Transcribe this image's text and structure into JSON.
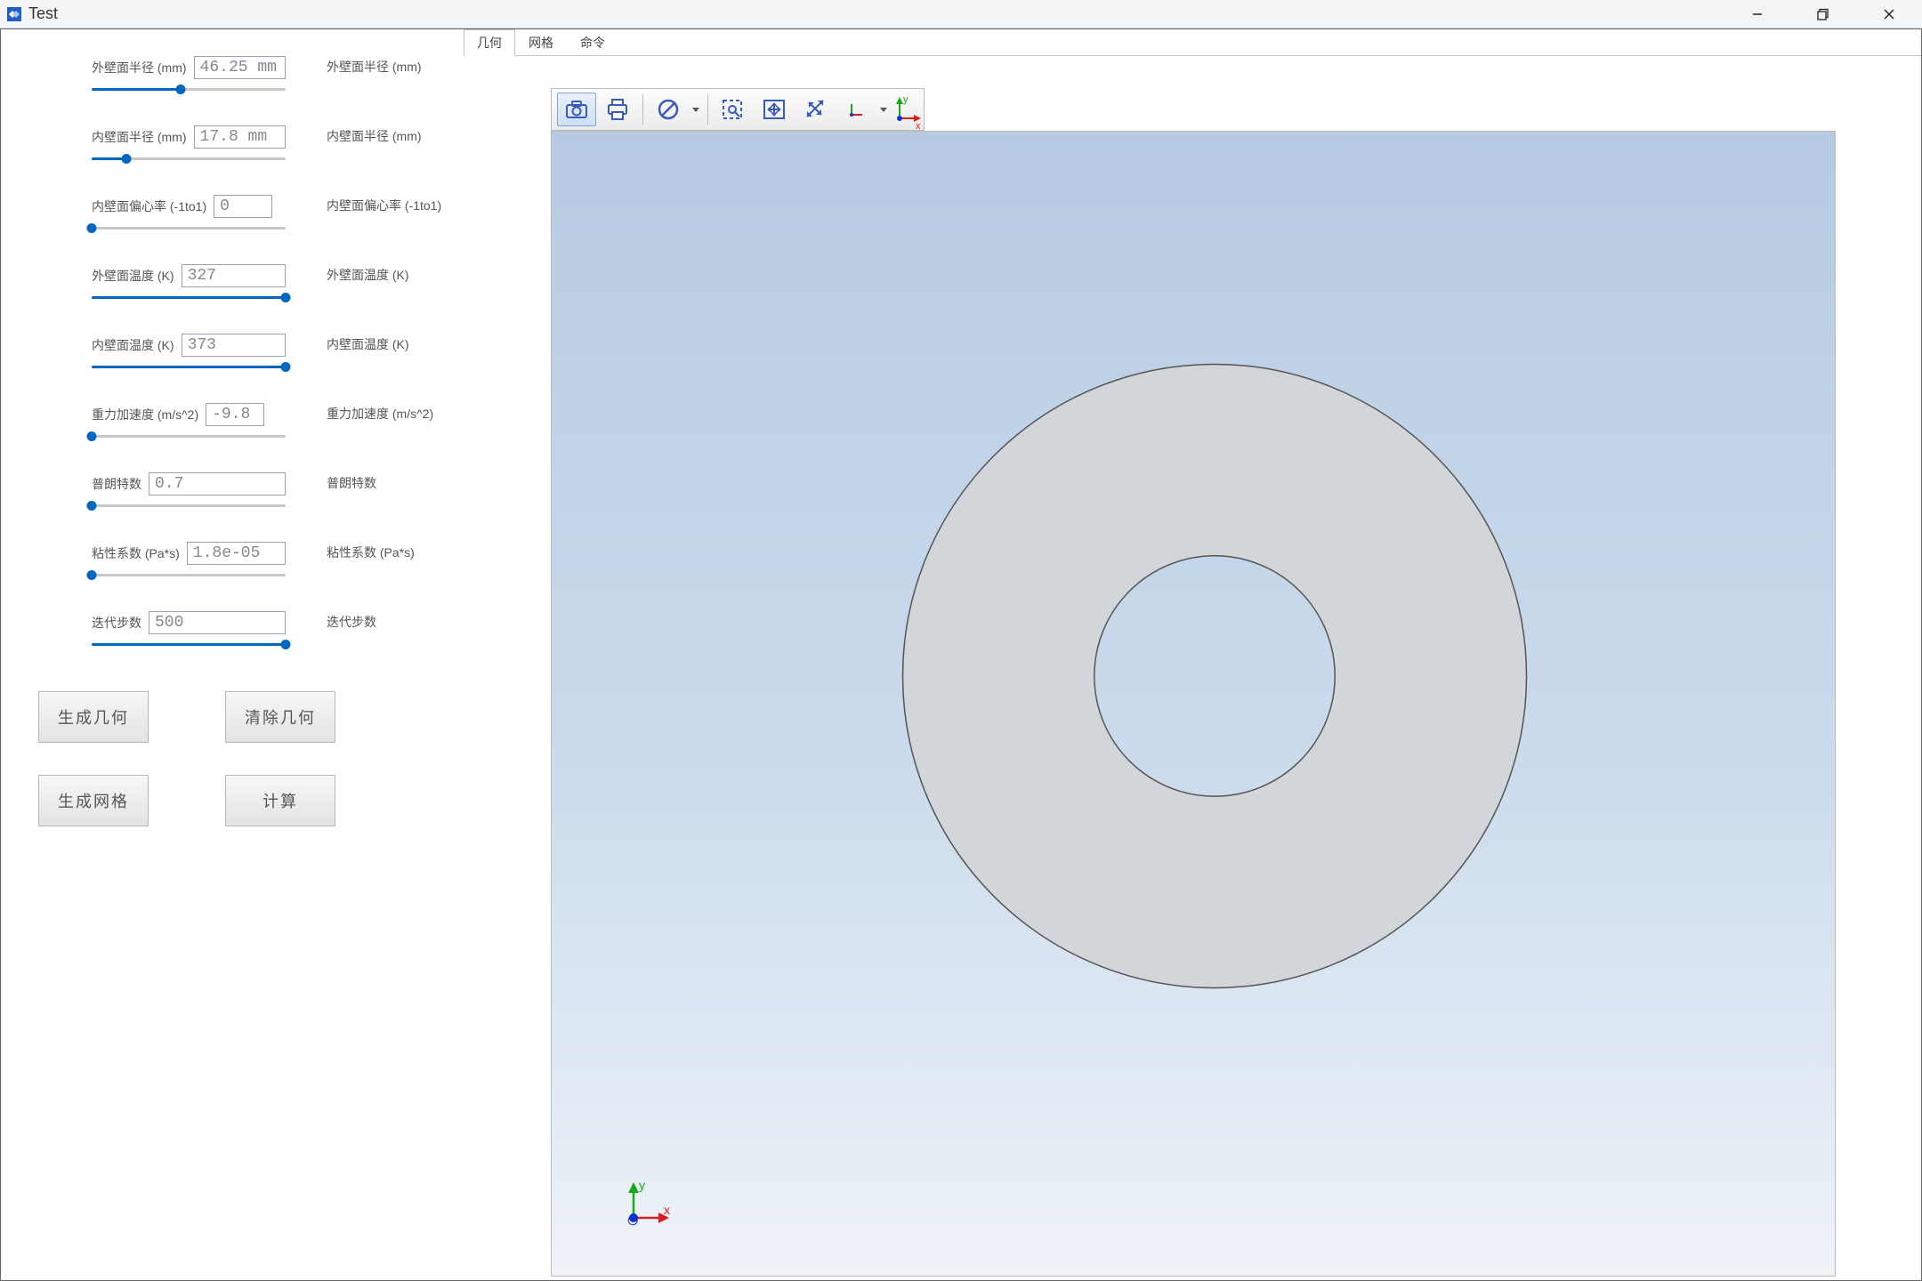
{
  "window": {
    "title": "Test"
  },
  "tabs": {
    "items": [
      "几何",
      "网格",
      "命令"
    ],
    "active": 0
  },
  "params": [
    {
      "label": "外壁面半径  (mm)",
      "echo": "外壁面半径  (mm)",
      "value": "46.25 mm",
      "fill": 46,
      "short": false
    },
    {
      "label": "内壁面半径  (mm)",
      "echo": "内壁面半径  (mm)",
      "value": "17.8 mm",
      "fill": 18,
      "short": false
    },
    {
      "label": "内壁面偏心率  (-1to1)",
      "echo": "内壁面偏心率  (-1to1)",
      "value": "0",
      "fill": 0,
      "short": true
    },
    {
      "label": "外壁面温度  (K)",
      "echo": "外壁面温度  (K)",
      "value": "327",
      "fill": 100,
      "short": false
    },
    {
      "label": "内壁面温度  (K)",
      "echo": "内壁面温度  (K)",
      "value": "373",
      "fill": 100,
      "short": false
    },
    {
      "label": "重力加速度  (m/s^2)",
      "echo": "重力加速度  (m/s^2)",
      "value": "-9.8",
      "fill": 0,
      "short": true
    },
    {
      "label": "普朗特数",
      "echo": "普朗特数",
      "value": "0.7",
      "fill": 0,
      "short": false
    },
    {
      "label": "粘性系数  (Pa*s)",
      "echo": "粘性系数  (Pa*s)",
      "value": "1.8e-05",
      "fill": 0,
      "short": false
    },
    {
      "label": "迭代步数",
      "echo": "迭代步数",
      "value": "500",
      "fill": 100,
      "short": false
    }
  ],
  "buttons": {
    "gen_geom": "生成几何",
    "clr_geom": "清除几何",
    "gen_mesh": "生成网格",
    "compute": "计算"
  },
  "toolbar3d": {
    "icons": [
      "camera-icon",
      "print-icon",
      "sep",
      "nodo-icon",
      "drop",
      "sep",
      "box-select-icon",
      "fit-icon",
      "diag-icon",
      "axis-icon",
      "drop"
    ]
  },
  "axis_labels": {
    "x": "x",
    "y": "y"
  }
}
